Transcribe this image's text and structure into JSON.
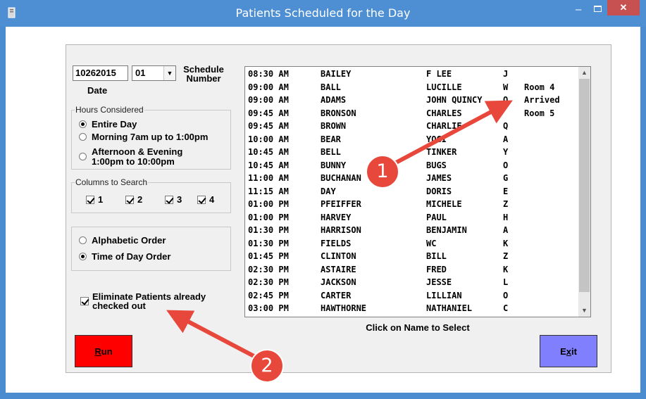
{
  "window": {
    "title": "Patients Scheduled for the Day",
    "minimize": "–",
    "close": "✕"
  },
  "form": {
    "date_value": "10262015",
    "date_label": "Date",
    "schedule_value": "01",
    "schedule_label": "Schedule Number",
    "hours_group": {
      "legend": "Hours Considered",
      "options": [
        {
          "label": "Entire Day",
          "selected": true
        },
        {
          "label": "Morning 7am up to 1:00pm",
          "selected": false
        },
        {
          "label": "Afternoon & Evening",
          "label2": "1:00pm to 10:00pm",
          "selected": false
        }
      ]
    },
    "columns_group": {
      "legend": "Columns to Search",
      "checks": [
        {
          "label": "1",
          "checked": true
        },
        {
          "label": "2",
          "checked": true
        },
        {
          "label": "3",
          "checked": true
        },
        {
          "label": "4",
          "checked": true
        }
      ]
    },
    "order_group": {
      "options": [
        {
          "label": "Alphabetic Order",
          "selected": false
        },
        {
          "label": "Time of Day Order",
          "selected": true
        }
      ]
    },
    "eliminate": {
      "label": "Eliminate Patients already",
      "label2": "checked out",
      "checked": true
    },
    "list_hint": "Click on Name to Select",
    "run_underlined": "R",
    "run_rest": "un",
    "exit_first": "E",
    "exit_underlined": "x",
    "exit_rest": "it"
  },
  "patients": [
    {
      "time": "08:30 AM",
      "last": "BAILEY",
      "first": "F LEE",
      "mi": "J",
      "status": ""
    },
    {
      "time": "09:00 AM",
      "last": "BALL",
      "first": "LUCILLE",
      "mi": "W",
      "status": "Room 4"
    },
    {
      "time": "09:00 AM",
      "last": "ADAMS",
      "first": "JOHN QUINCY",
      "mi": "Q",
      "status": "Arrived"
    },
    {
      "time": "09:45 AM",
      "last": "BRONSON",
      "first": "CHARLES",
      "mi": "",
      "status": "Room 5"
    },
    {
      "time": "09:45 AM",
      "last": "BROWN",
      "first": "CHARLIE",
      "mi": "Q",
      "status": ""
    },
    {
      "time": "10:00 AM",
      "last": "BEAR",
      "first": "YOGI",
      "mi": "A",
      "status": ""
    },
    {
      "time": "10:45 AM",
      "last": "BELL",
      "first": "TINKER",
      "mi": "Y",
      "status": ""
    },
    {
      "time": "10:45 AM",
      "last": "BUNNY",
      "first": "BUGS",
      "mi": "O",
      "status": ""
    },
    {
      "time": "11:00 AM",
      "last": "BUCHANAN",
      "first": "JAMES",
      "mi": "G",
      "status": ""
    },
    {
      "time": "11:15 AM",
      "last": "DAY",
      "first": "DORIS",
      "mi": "E",
      "status": ""
    },
    {
      "time": "01:00 PM",
      "last": "PFEIFFER",
      "first": "MICHELE",
      "mi": "Z",
      "status": ""
    },
    {
      "time": "01:00 PM",
      "last": "HARVEY",
      "first": "PAUL",
      "mi": "H",
      "status": ""
    },
    {
      "time": "01:30 PM",
      "last": "HARRISON",
      "first": "BENJAMIN",
      "mi": "A",
      "status": ""
    },
    {
      "time": "01:30 PM",
      "last": "FIELDS",
      "first": "WC",
      "mi": "K",
      "status": ""
    },
    {
      "time": "01:45 PM",
      "last": "CLINTON",
      "first": "BILL",
      "mi": "Z",
      "status": ""
    },
    {
      "time": "02:30 PM",
      "last": "ASTAIRE",
      "first": "FRED",
      "mi": "K",
      "status": ""
    },
    {
      "time": "02:30 PM",
      "last": "JACKSON",
      "first": "JESSE",
      "mi": "L",
      "status": ""
    },
    {
      "time": "02:45 PM",
      "last": "CARTER",
      "first": "LILLIAN",
      "mi": "O",
      "status": ""
    },
    {
      "time": "03:00 PM",
      "last": "HAWTHORNE",
      "first": "NATHANIEL",
      "mi": "C",
      "status": ""
    }
  ],
  "annotations": [
    {
      "number": "1",
      "color": "#e8473b"
    },
    {
      "number": "2",
      "color": "#e8473b"
    }
  ]
}
